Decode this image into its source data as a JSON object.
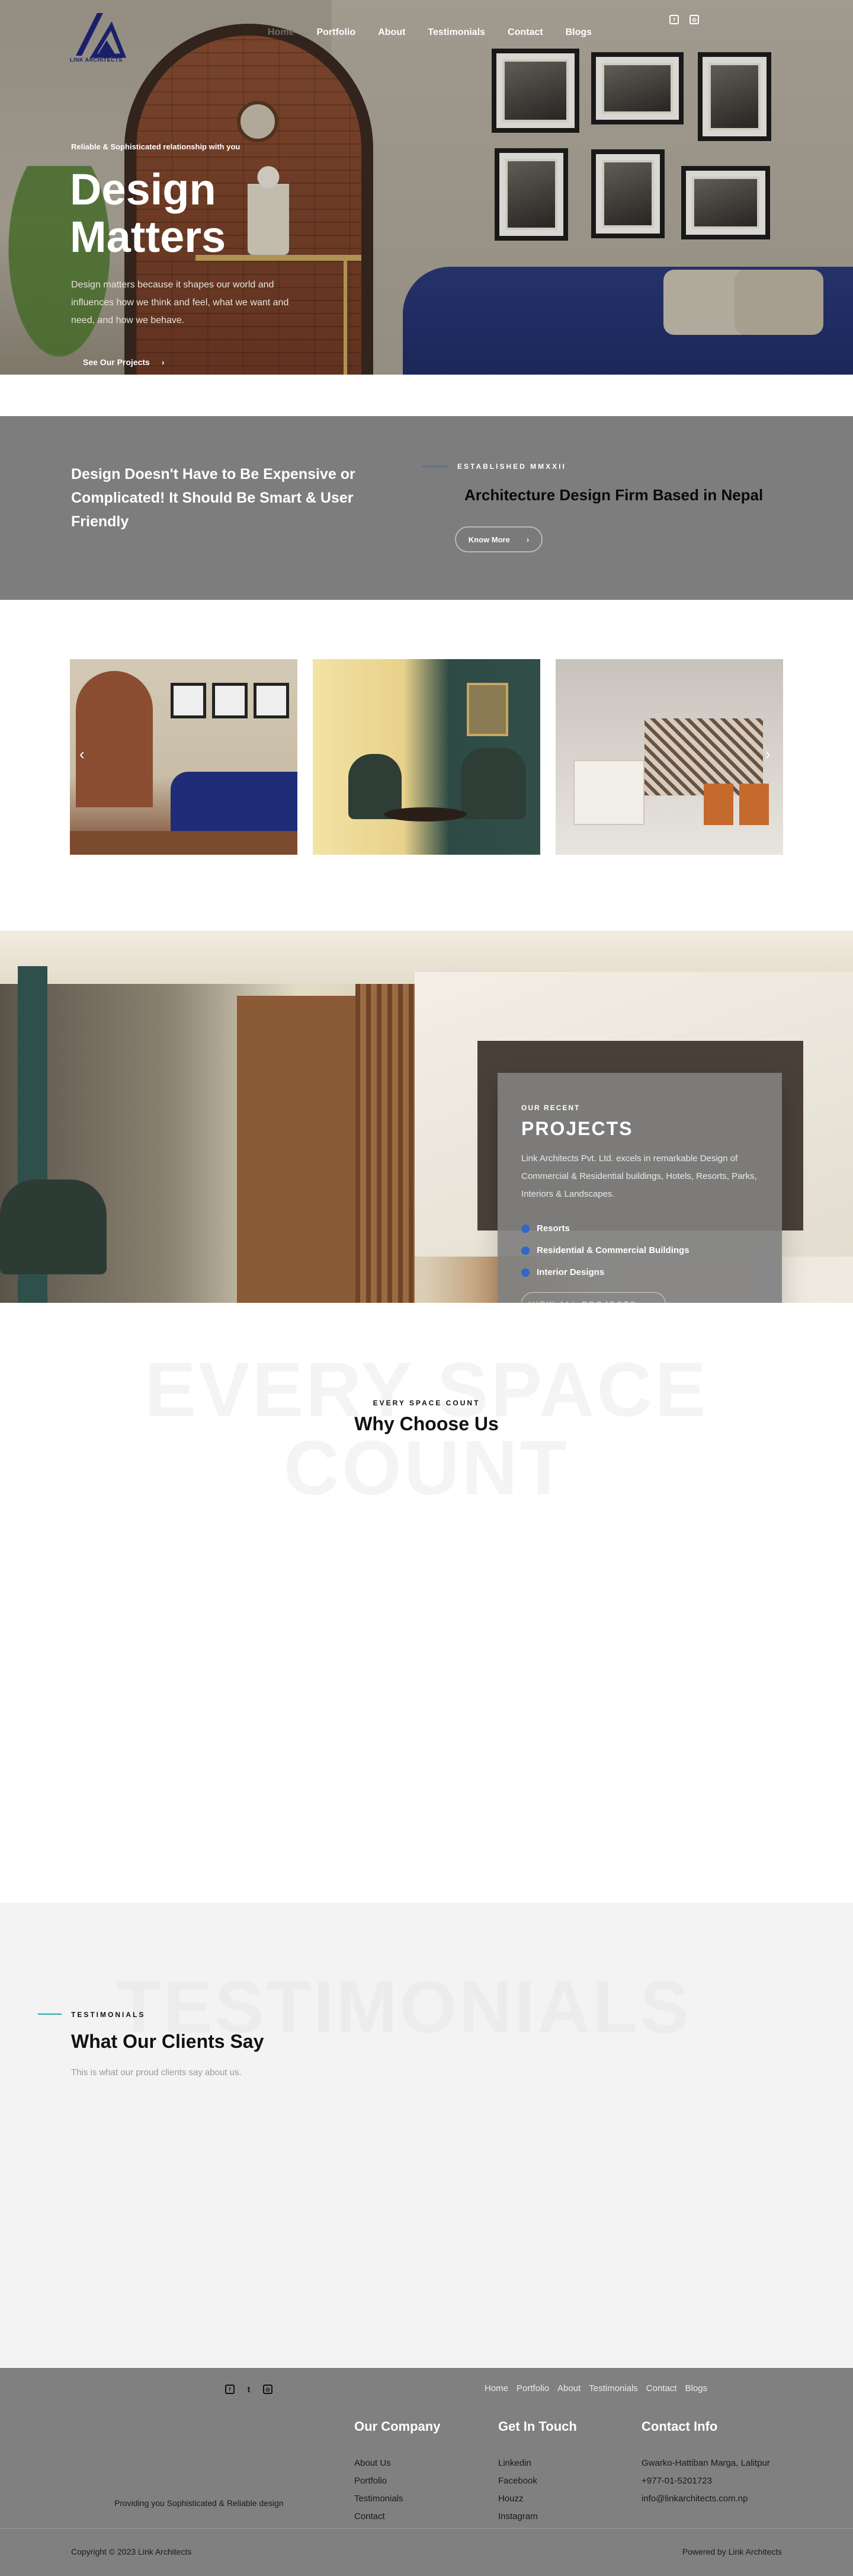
{
  "brand": {
    "logo_text": "LINK ARCHITECTS",
    "accent": "#1b1f6a"
  },
  "nav": {
    "items": [
      {
        "label": "Home"
      },
      {
        "label": "Portfolio"
      },
      {
        "label": "About"
      },
      {
        "label": "Testimonials"
      },
      {
        "label": "Contact"
      },
      {
        "label": "Blogs"
      }
    ],
    "social": [
      {
        "icon": "facebook-icon",
        "glyph": "f"
      },
      {
        "icon": "instagram-icon",
        "glyph": "◎"
      }
    ]
  },
  "hero": {
    "tag": "Reliable & Sophisticated relationship with you",
    "title_line1": "Design",
    "title_line2": "Matters",
    "description": "Design matters because it shapes our world and influences how we think and feel, what we want and need, and how we behave.",
    "cta": "See Our Projects",
    "cta_arrow": "›"
  },
  "banner": {
    "left_text": "Design Doesn't Have to Be Expensive or Complicated! It Should Be Smart & User Friendly",
    "eyebrow": "ESTABLISHED MMXXII",
    "title": "Architecture Design Firm Based in Nepal",
    "button": "Know More",
    "button_arrow": "›"
  },
  "carousel": {
    "prev": "‹",
    "next": "›",
    "dots_count": 12,
    "active_index": 0
  },
  "projects": {
    "eyebrow": "OUR RECENT",
    "title": "PROJECTS",
    "description": "Link Architects Pvt. Ltd. excels in remarkable Design of Commercial & Residential buildings, Hotels, Resorts, Parks, Interiors & Landscapes.",
    "items": [
      {
        "label": "Resorts"
      },
      {
        "label": "Residential & Commercial Buildings"
      },
      {
        "label": "Interior Designs"
      }
    ],
    "button": "VIEW ALL PROJECTS",
    "button_arrow": "›",
    "bullet_color": "#2f68c7"
  },
  "why": {
    "bg_line1": "EVERY SPACE",
    "bg_line2": "COUNT",
    "eyebrow": "EVERY SPACE COUNT",
    "title": "Why Choose Us"
  },
  "testimonials": {
    "bg_text": "TESTIMONIALS",
    "eyebrow": "TESTIMONIALS",
    "title": "What Our Clients Say",
    "subtitle": "This is what our proud clients say about us.",
    "accent": "#2ba7a7"
  },
  "footer": {
    "social": [
      {
        "icon": "facebook-icon",
        "glyph": "f"
      },
      {
        "icon": "twitter-icon",
        "glyph": "t"
      },
      {
        "icon": "instagram-icon",
        "glyph": "◎"
      }
    ],
    "links": [
      {
        "label": "Home"
      },
      {
        "label": "Portfolio"
      },
      {
        "label": "About"
      },
      {
        "label": "Testimonials"
      },
      {
        "label": "Contact"
      },
      {
        "label": "Blogs"
      }
    ],
    "tagline": "Providing you Sophisticated & Reliable design",
    "company": {
      "heading": "Our Company",
      "links": [
        {
          "label": "About Us"
        },
        {
          "label": "Portfolio"
        },
        {
          "label": "Testimonials"
        },
        {
          "label": "Contact"
        }
      ]
    },
    "touch": {
      "heading": "Get In Touch",
      "links": [
        {
          "label": "Linkedin"
        },
        {
          "label": "Facebook"
        },
        {
          "label": "Houzz"
        },
        {
          "label": "Instagram"
        }
      ]
    },
    "contact": {
      "heading": "Contact Info",
      "address": "Gwarko-Hattiban Marga, Lalitpur",
      "phone": "+977-01-5201723",
      "email": "info@linkarchitects.com.np"
    },
    "copyright": "Copyright © 2023 Link Architects",
    "powered": "Powered by Link Architects"
  }
}
